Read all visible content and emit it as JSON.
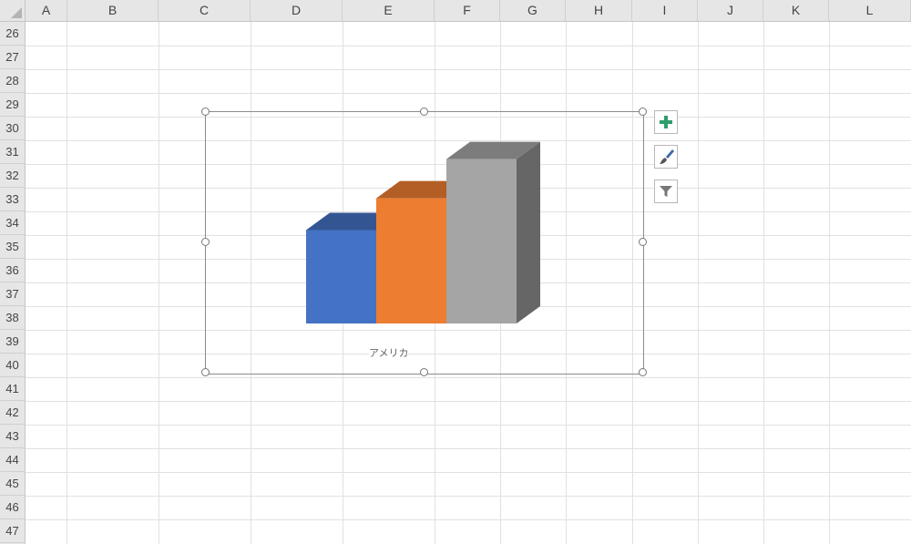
{
  "columns": [
    "A",
    "B",
    "C",
    "D",
    "E",
    "F",
    "G",
    "H",
    "I",
    "J",
    "K",
    "L"
  ],
  "rows": [
    "26",
    "27",
    "28",
    "29",
    "30",
    "31",
    "32",
    "33",
    "34",
    "35",
    "36",
    "37",
    "38",
    "39",
    "40",
    "41",
    "42",
    "43",
    "44",
    "45",
    "46",
    "47"
  ],
  "chart": {
    "category_label": "アメリカ",
    "buttons": [
      {
        "name": "chart-elements-button",
        "icon": "plus-icon"
      },
      {
        "name": "chart-styles-button",
        "icon": "paintbrush-icon"
      },
      {
        "name": "chart-filters-button",
        "icon": "funnel-icon"
      }
    ]
  },
  "chart_data": {
    "type": "bar",
    "categories": [
      "アメリカ"
    ],
    "series": [
      {
        "color": "#4472c4",
        "values": [
          50
        ]
      },
      {
        "color": "#ed7d31",
        "values": [
          67
        ]
      },
      {
        "color": "#a5a5a5",
        "values": [
          88
        ]
      }
    ],
    "ylim": [
      0,
      100
    ],
    "grid": false,
    "legend": "none"
  },
  "colors": {
    "map_yellow": "#f7c84a",
    "map_orange": "#ef9a3f",
    "map_red": "#e24a2f"
  }
}
